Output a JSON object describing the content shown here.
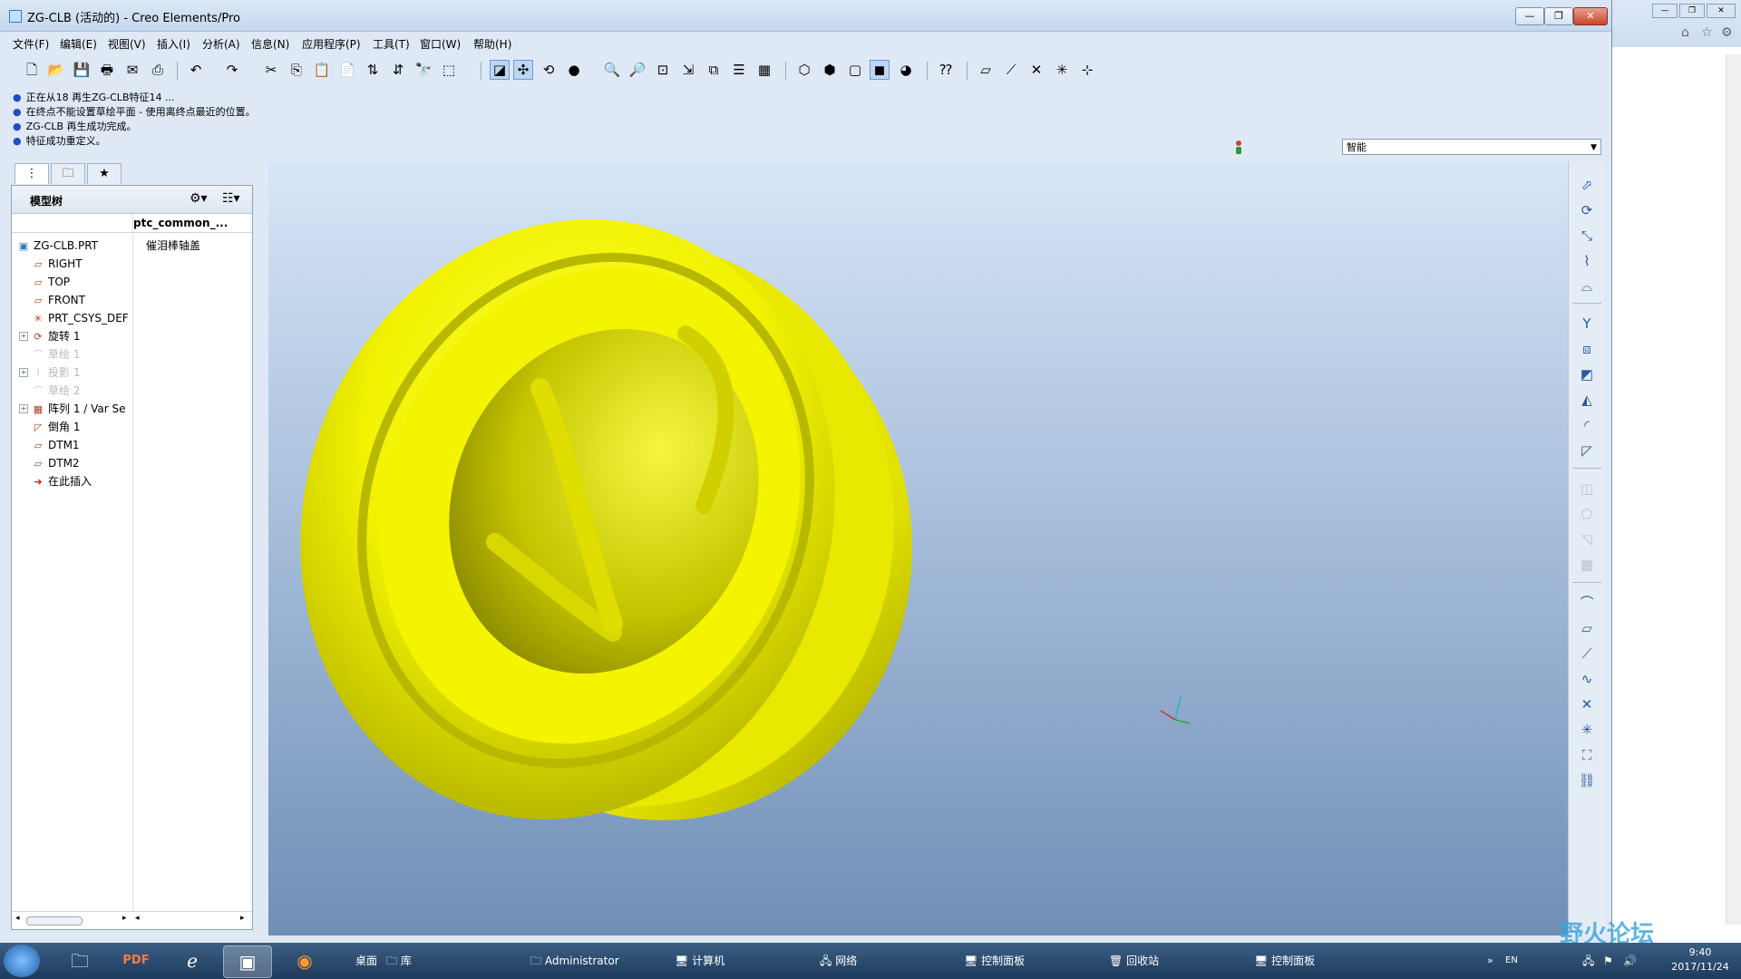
{
  "window": {
    "title": "ZG-CLB (活动的) - Creo Elements/Pro",
    "controls": [
      "—",
      "❐",
      "✕"
    ]
  },
  "menubar": [
    "文件(F)",
    "编辑(E)",
    "视图(V)",
    "插入(I)",
    "分析(A)",
    "信息(N)",
    "应用程序(P)",
    "工具(T)",
    "窗口(W)",
    "帮助(H)"
  ],
  "messages": [
    "正在从18 再生ZG-CLB特征14 ...",
    "在终点不能设置草绘平面 - 使用离终点最近的位置。",
    "ZG-CLB 再生成功完成。",
    "特征成功重定义。"
  ],
  "filter": {
    "value": "智能"
  },
  "model_tree": {
    "header": "模型树",
    "column": "ptc_common_...",
    "root": {
      "label": "ZG-CLB.PRT",
      "value": "催泪棒轴盖"
    },
    "items": [
      {
        "label": "RIGHT",
        "icon": "datum-plane-icon",
        "dim": false,
        "expand": false
      },
      {
        "label": "TOP",
        "icon": "datum-plane-icon",
        "dim": false,
        "expand": false
      },
      {
        "label": "FRONT",
        "icon": "datum-plane-icon",
        "dim": false,
        "expand": false
      },
      {
        "label": "PRT_CSYS_DEF",
        "icon": "csys-icon",
        "dim": false,
        "expand": false
      },
      {
        "label": "旋转 1",
        "icon": "revolve-icon",
        "dim": false,
        "expand": true
      },
      {
        "label": "草绘 1",
        "icon": "sketch-icon",
        "dim": true,
        "expand": false
      },
      {
        "label": "投影 1",
        "icon": "projection-icon",
        "dim": true,
        "expand": true
      },
      {
        "label": "草绘 2",
        "icon": "sketch-icon",
        "dim": true,
        "expand": false
      },
      {
        "label": "阵列 1 / Var Se",
        "icon": "pattern-icon",
        "dim": false,
        "expand": true
      },
      {
        "label": "倒角 1",
        "icon": "chamfer-icon",
        "dim": false,
        "expand": false
      },
      {
        "label": "DTM1",
        "icon": "datum-plane-icon",
        "dim": false,
        "expand": false
      },
      {
        "label": "DTM2",
        "icon": "datum-plane-icon",
        "dim": false,
        "expand": false
      },
      {
        "label": "在此插入",
        "icon": "insert-here-icon",
        "dim": false,
        "expand": false
      }
    ]
  },
  "colors": {
    "model": "#ffff00",
    "model_shadow": "#c8c800",
    "bg_top": "#d7e6f7",
    "bg_bottom": "#6f8fb6"
  },
  "taskbar": {
    "items": [
      "桌面",
      "库",
      "Administrator",
      "计算机",
      "网络",
      "控制面板",
      "回收站",
      "控制面板"
    ],
    "lang": "EN",
    "time": "9:40",
    "date": "2017/11/24"
  },
  "watermark": "野火论坛"
}
